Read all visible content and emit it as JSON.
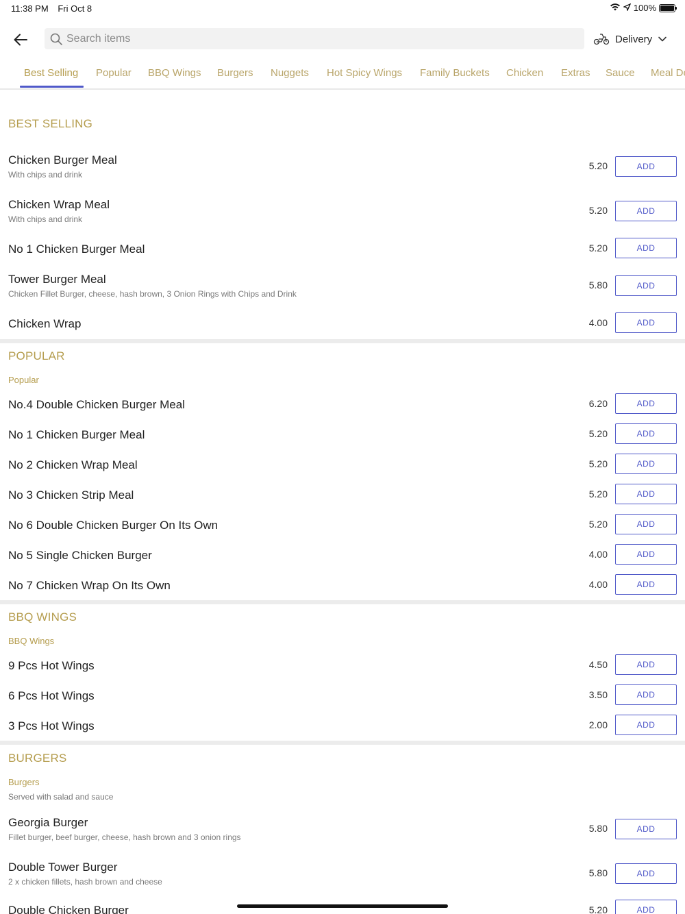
{
  "status": {
    "time": "11:38 PM",
    "date": "Fri Oct 8",
    "battery": "100%"
  },
  "search": {
    "placeholder": "Search items"
  },
  "delivery": {
    "label": "Delivery"
  },
  "tabs": [
    "Best Selling",
    "Popular",
    "BBQ Wings",
    "Burgers",
    "Nuggets",
    "Hot Spicy Wings",
    "Family Buckets",
    "Chicken",
    "Extras",
    "Sauce",
    "Meal Deals"
  ],
  "active_tab": "Best Selling",
  "add_label": "ADD",
  "sections": {
    "best_selling": {
      "title": "BEST SELLING",
      "items": [
        {
          "name": "Chicken Burger Meal",
          "desc": "With chips and drink",
          "price": "5.20"
        },
        {
          "name": "Chicken Wrap Meal",
          "desc": "With chips and drink",
          "price": "5.20"
        },
        {
          "name": "No 1 Chicken Burger Meal",
          "desc": "",
          "price": "5.20"
        },
        {
          "name": "Tower Burger Meal",
          "desc": "Chicken Fillet Burger, cheese, hash brown, 3 Onion Rings with Chips and Drink",
          "price": "5.80"
        },
        {
          "name": "Chicken Wrap",
          "desc": "",
          "price": "4.00"
        }
      ]
    },
    "popular": {
      "title": "POPULAR",
      "subtitle": "Popular",
      "items": [
        {
          "name": "No.4 Double Chicken Burger Meal",
          "price": "6.20"
        },
        {
          "name": "No 1 Chicken Burger Meal",
          "price": "5.20"
        },
        {
          "name": "No 2 Chicken Wrap Meal",
          "price": "5.20"
        },
        {
          "name": "No 3 Chicken Strip Meal",
          "price": "5.20"
        },
        {
          "name": "No 6 Double Chicken Burger On Its Own",
          "price": "5.20"
        },
        {
          "name": "No 5 Single Chicken Burger",
          "price": "4.00"
        },
        {
          "name": "No 7 Chicken Wrap On Its Own",
          "price": "4.00"
        }
      ]
    },
    "bbq_wings": {
      "title": "BBQ WINGS",
      "subtitle": "BBQ Wings",
      "items": [
        {
          "name": "9 Pcs Hot Wings",
          "price": "4.50"
        },
        {
          "name": "6 Pcs Hot Wings",
          "price": "3.50"
        },
        {
          "name": "3 Pcs Hot Wings",
          "price": "2.00"
        }
      ]
    },
    "burgers": {
      "title": "BURGERS",
      "subtitle": "Burgers",
      "note": "Served with salad and sauce",
      "items": [
        {
          "name": "Georgia Burger",
          "desc": "Fillet burger, beef burger, cheese, hash brown and 3 onion rings",
          "price": "5.80"
        },
        {
          "name": "Double Tower Burger",
          "desc": "2 x chicken fillets, hash brown and cheese",
          "price": "5.80"
        },
        {
          "name": "Double Chicken Burger",
          "desc": "",
          "price": "5.20"
        }
      ]
    }
  }
}
